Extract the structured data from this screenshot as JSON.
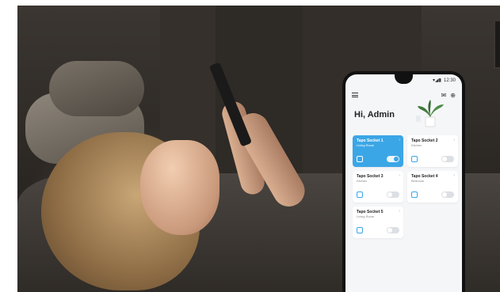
{
  "status": {
    "time": "12:30"
  },
  "header": {
    "greeting": "Hi, Admin"
  },
  "devices": [
    {
      "name": "Tapo Socket 1",
      "room": "Living Room",
      "on": true
    },
    {
      "name": "Tapo Socket 2",
      "room": "Kitchen",
      "on": false
    },
    {
      "name": "Tapo Socket 3",
      "room": "Kitchen",
      "on": false
    },
    {
      "name": "Tapo Socket 4",
      "room": "Bedroom",
      "on": false
    },
    {
      "name": "Tapo Socket 5",
      "room": "Living Room",
      "on": false
    }
  ],
  "colors": {
    "accent": "#3ba6e6",
    "screen_bg": "#f5f6f8"
  },
  "icons": [
    "menu-icon",
    "mail-icon",
    "add-icon",
    "chevron-right-icon",
    "socket-icon"
  ]
}
